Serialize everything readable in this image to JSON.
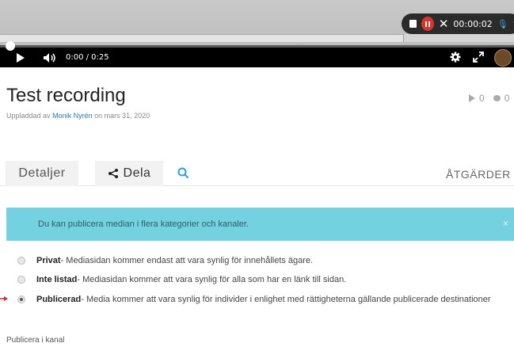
{
  "player": {
    "time_readout": "0:00  / 0:25",
    "recorder_time": "00:00:02",
    "progress": 0.0
  },
  "page": {
    "title": "Test recording",
    "uploaded_prefix": "Uppladdad av",
    "uploader": "Monik Nyrén",
    "uploaded_suffix": "on mars 31, 2020",
    "views": "0",
    "comments": "0"
  },
  "tabs": {
    "details": "Detaljer",
    "share": "Dela",
    "actions": "ÅTGÄRDER"
  },
  "alert": {
    "text": "Du kan publicera median i flera kategorier och kanaler.",
    "close": "×"
  },
  "options": [
    {
      "label": "Privat",
      "desc": " - Mediasidan kommer endast att vara synlig för innehållets ägare.",
      "checked": false
    },
    {
      "label": "Inte listad",
      "desc": " - Mediasidan kommer att vara synlig för alla som har en länk till sidan.",
      "checked": false
    },
    {
      "label": "Publicerad",
      "desc": " - Media kommer att vara synlig för individer i enlighet med rättigheterna gällande publicerade destinationer",
      "checked": true
    }
  ],
  "channel_label": "Publicera i kanal",
  "colors": {
    "alert_bg": "#74d2e0",
    "link": "#2a7ab8",
    "record_red": "#d9342b",
    "search_blue": "#2aa3d8"
  }
}
